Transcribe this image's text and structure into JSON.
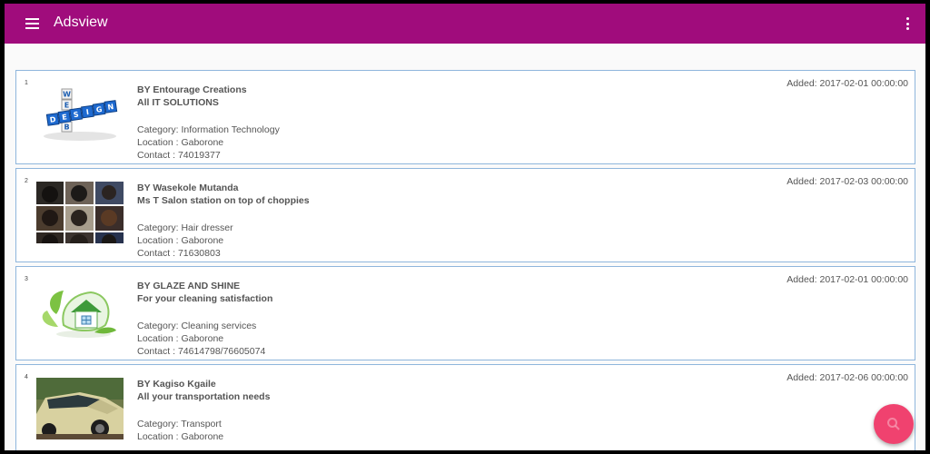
{
  "app": {
    "title": "Adsview",
    "menu_icon": "hamburger-menu-icon",
    "overflow_icon": "more-vertical-icon",
    "colors": {
      "appbar": "#a00c7c",
      "fab": "#f0426f",
      "card_border": "#8fb6dc"
    }
  },
  "ads": [
    {
      "index": "1",
      "by": "BY Entourage Creations",
      "headline": "All IT SOLUTIONS",
      "category": "Category: Information Technology",
      "location": "Location : Gaborone",
      "contact": "Contact   : 74019377",
      "added": "Added: 2017-02-01 00:00:00",
      "thumb_letters": [
        "W",
        "E",
        "B",
        "D",
        "S",
        "I",
        "G",
        "N"
      ]
    },
    {
      "index": "2",
      "by": "BY Wasekole Mutanda",
      "headline": "Ms T Salon station on top of choppies",
      "category": "Category: Hair dresser",
      "location": "Location : Gaborone",
      "contact": "Contact   : 71630803",
      "added": "Added: 2017-02-03 00:00:00"
    },
    {
      "index": "3",
      "by": "BY GLAZE AND SHINE",
      "headline": "For your cleaning satisfaction",
      "category": "Category: Cleaning services",
      "location": "Location : Gaborone",
      "contact": "Contact   : 74614798/76605074",
      "added": "Added: 2017-02-01 00:00:00"
    },
    {
      "index": "4",
      "by": "BY Kagiso Kgaile",
      "headline": "All your transportation needs",
      "category": "Category: Transport",
      "location": "Location : Gaborone",
      "contact": "",
      "added": "Added: 2017-02-06 00:00:00"
    }
  ],
  "fab": {
    "icon": "search-icon"
  }
}
